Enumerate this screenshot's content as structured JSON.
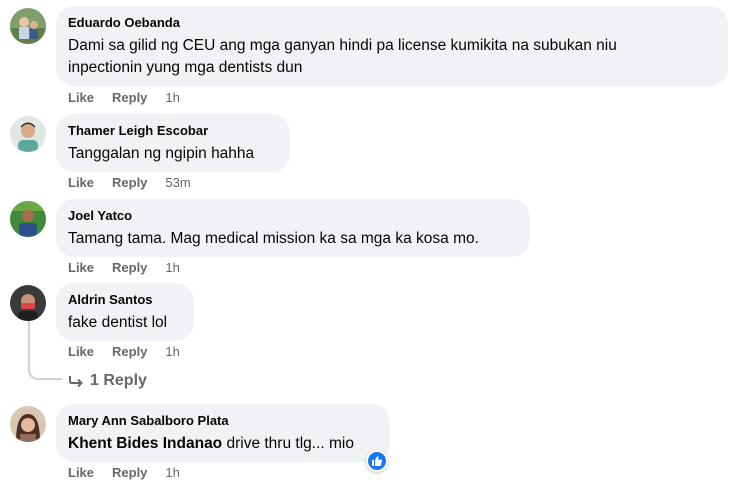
{
  "comments": [
    {
      "author": "Eduardo Oebanda",
      "text_lines": [
        "Dami sa gilid ng CEU ang mga ganyan hindi pa license kumikita na subukan niu",
        "inpectionin yung mga dentists dun"
      ],
      "like_label": "Like",
      "reply_label": "Reply",
      "time": "1h"
    },
    {
      "author": "Thamer Leigh Escobar",
      "text": "Tanggalan ng ngipin hahha",
      "like_label": "Like",
      "reply_label": "Reply",
      "time": "53m"
    },
    {
      "author": "Joel Yatco",
      "text": "Tamang tama. Mag medical mission ka sa mga ka kosa mo.",
      "like_label": "Like",
      "reply_label": "Reply",
      "time": "1h"
    },
    {
      "author": "Aldrin Santos",
      "text": "fake dentist lol",
      "like_label": "Like",
      "reply_label": "Reply",
      "time": "1h",
      "replies_label": "1 Reply"
    },
    {
      "author": "Mary Ann Sabalboro Plata",
      "mention": "Khent Bides Indanao",
      "text": "drive thru tlg... mio",
      "like_label": "Like",
      "reply_label": "Reply",
      "time": "1h",
      "reaction": "like-reaction-icon"
    }
  ],
  "colors": {
    "bubble": "#f0f2f5",
    "meta": "#65676b",
    "like_blue": "#1877f2"
  }
}
